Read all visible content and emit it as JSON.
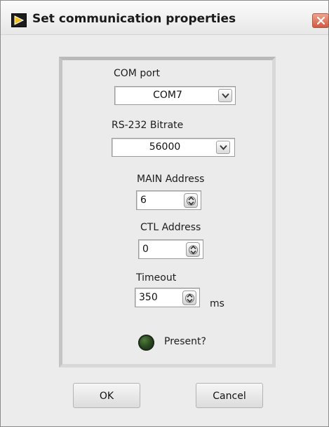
{
  "window": {
    "title": "Set communication properties"
  },
  "com_port": {
    "label": "COM port",
    "value": "COM7"
  },
  "bitrate": {
    "label": "RS-232 Bitrate",
    "value": "56000"
  },
  "main_address": {
    "label": "MAIN Address",
    "value": "6"
  },
  "ctl_address": {
    "label": "CTL Address",
    "value": "0"
  },
  "timeout": {
    "label": "Timeout",
    "value": "350",
    "unit": "ms"
  },
  "present": {
    "label": "Present?",
    "state": "off"
  },
  "buttons": {
    "ok": "OK",
    "cancel": "Cancel"
  },
  "icons": {
    "app": "labview-vi-icon",
    "close": "close-icon",
    "dropdown": "chevron-down-icon",
    "spinner": "spinner-arrows-icon"
  },
  "colors": {
    "led_off": "#2a4a1f",
    "close_button": "#d3593f",
    "panel": "#ebebeb"
  }
}
